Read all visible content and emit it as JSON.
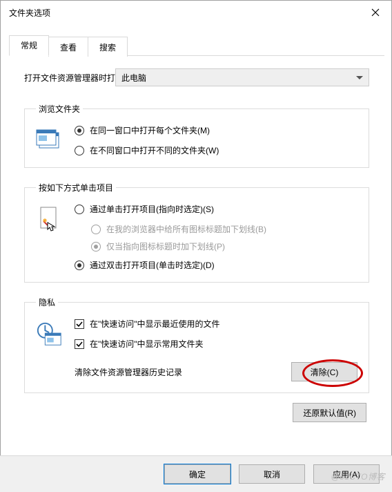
{
  "window": {
    "title": "文件夹选项"
  },
  "tabs": {
    "items": [
      {
        "label": "常规"
      },
      {
        "label": "查看"
      },
      {
        "label": "搜索"
      }
    ],
    "active": 0
  },
  "openWith": {
    "label": "打开文件资源管理器时打",
    "value": "此电脑"
  },
  "browse": {
    "legend": "浏览文件夹",
    "opt_same": "在同一窗口中打开每个文件夹(M)",
    "opt_new": "在不同窗口中打开不同的文件夹(W)"
  },
  "click": {
    "legend": "按如下方式单击项目",
    "opt_single": "通过单击打开项目(指向时选定)(S)",
    "sub_all": "在我的浏览器中给所有图标标题加下划线(B)",
    "sub_point": "仅当指向图标标题时加下划线(P)",
    "opt_double": "通过双击打开项目(单击时选定)(D)"
  },
  "privacy": {
    "legend": "隐私",
    "chk_recent": "在\"快速访问\"中显示最近使用的文件",
    "chk_frequent": "在\"快速访问\"中显示常用文件夹",
    "clear_label": "清除文件资源管理器历史记录",
    "clear_btn": "清除(C)"
  },
  "restore_btn": "还原默认值(R)",
  "buttons": {
    "ok": "确定",
    "cancel": "取消",
    "apply": "应用(A)"
  },
  "watermark": "@51CTO博客"
}
